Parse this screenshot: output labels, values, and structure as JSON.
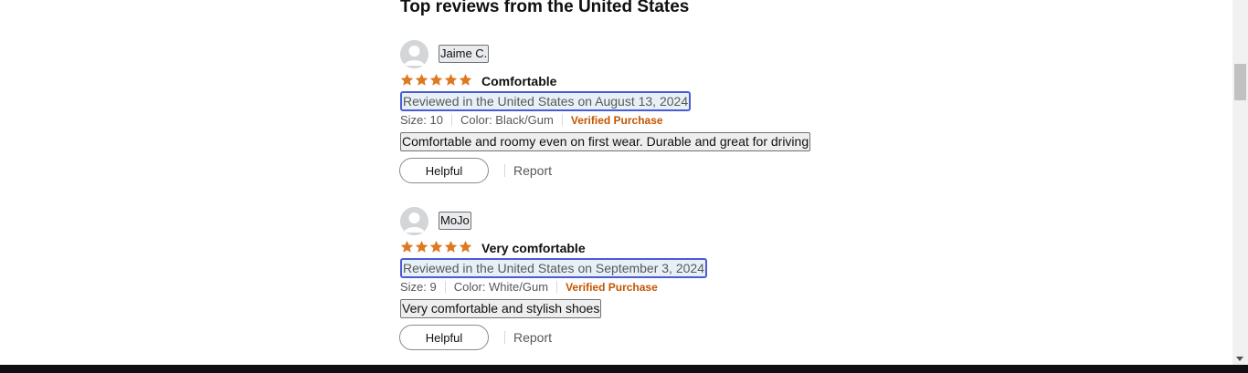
{
  "section": {
    "title": "Top reviews from the United States"
  },
  "reviews": [
    {
      "profile_name": "Jaime C.",
      "rating": 5,
      "title": "Comfortable",
      "date": "Reviewed in the United States on August 13, 2024",
      "size": "Size: 10",
      "color": "Color: Black/Gum",
      "verified": "Verified Purchase",
      "body": "Comfortable and roomy even on first wear. Durable and great for driving",
      "helpful_label": "Helpful",
      "report_label": "Report"
    },
    {
      "profile_name": "MoJo",
      "rating": 5,
      "title": "Very comfortable",
      "date": "Reviewed in the United States on September 3, 2024",
      "size": "Size: 9",
      "color": "Color: White/Gum",
      "verified": "Verified Purchase",
      "body": "Very comfortable and stylish shoes",
      "helpful_label": "Helpful",
      "report_label": "Report"
    }
  ],
  "icons": {
    "avatar": "person-avatar-icon",
    "star": "filled-star-icon"
  },
  "colors": {
    "star": "#de7921",
    "verified": "#c45500",
    "date_highlight_border": "#4b5bd6"
  }
}
